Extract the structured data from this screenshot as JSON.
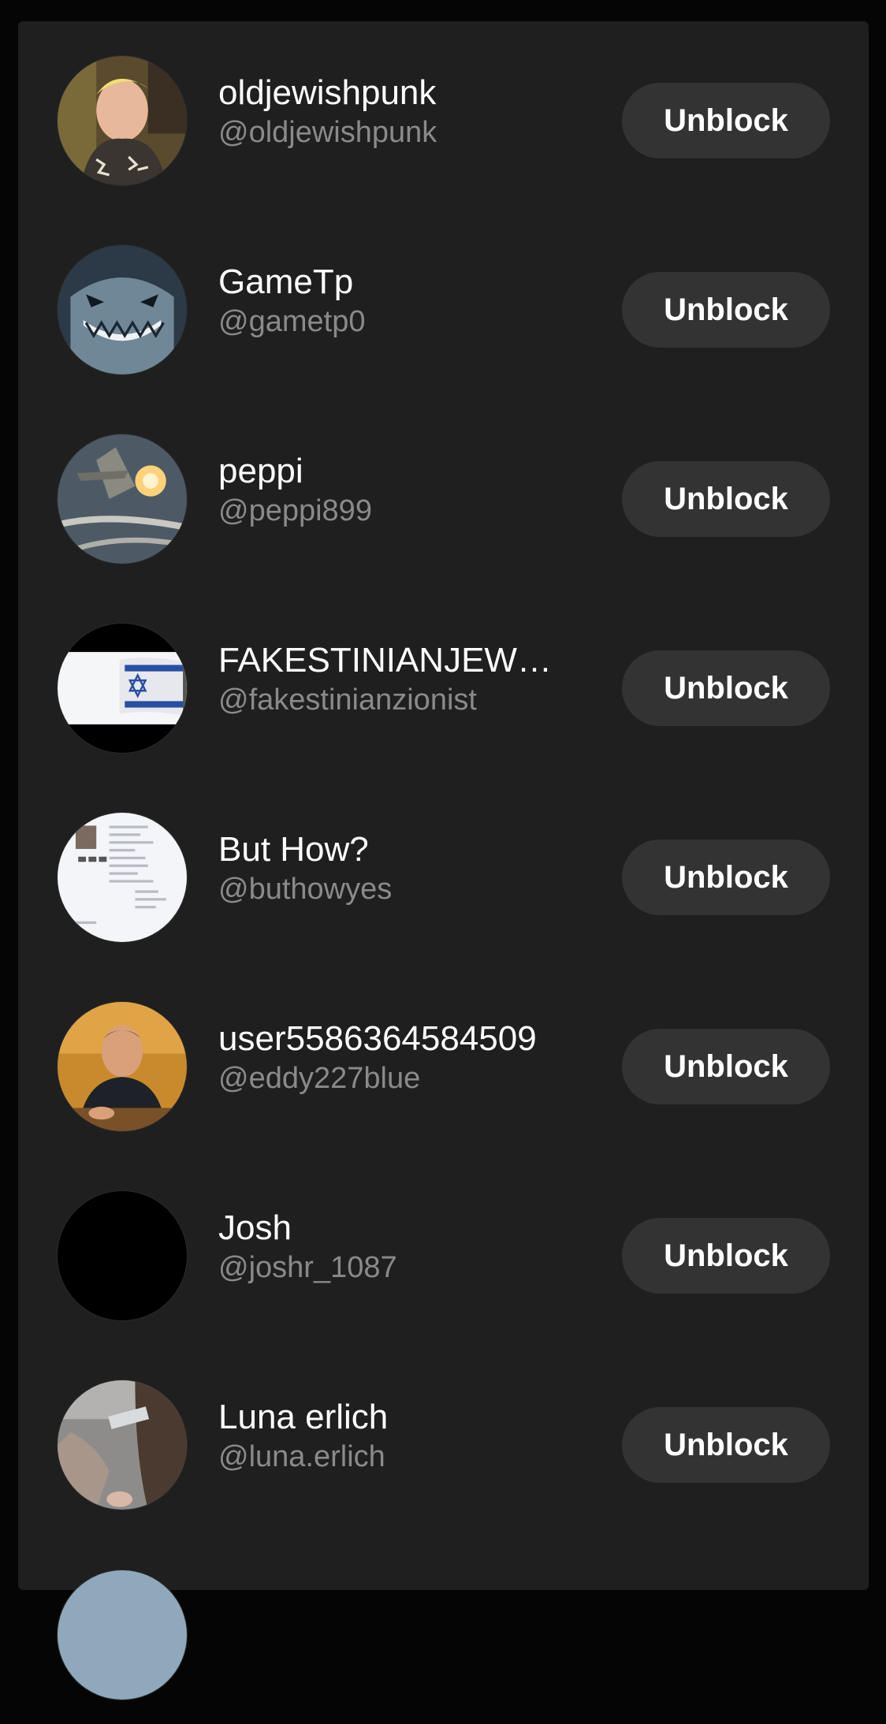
{
  "blocked_accounts": [
    {
      "display_name": "oldjewishpunk",
      "handle": "@oldjewishpunk",
      "avatar": "portrait-photo-avatar",
      "button_label": "Unblock"
    },
    {
      "display_name": "GameTp",
      "handle": "@gametp0",
      "avatar": "shark-character-avatar",
      "button_label": "Unblock"
    },
    {
      "display_name": "peppi",
      "handle": "@peppi899",
      "avatar": "fighter-jet-flares-avatar",
      "button_label": "Unblock"
    },
    {
      "display_name": "FAKESTINIANJEW…",
      "handle": "@fakestinianzionist",
      "avatar": "israel-flag-avatar",
      "button_label": "Unblock"
    },
    {
      "display_name": "But How?",
      "handle": "@buthowyes",
      "avatar": "document-screenshot-avatar",
      "button_label": "Unblock"
    },
    {
      "display_name": "user5586364584509",
      "handle": "@eddy227blue",
      "avatar": "man-photo-avatar",
      "button_label": "Unblock"
    },
    {
      "display_name": "Josh",
      "handle": "@joshr_1087",
      "avatar": "black-avatar",
      "button_label": "Unblock"
    },
    {
      "display_name": "Luna erlich",
      "handle": "@luna.erlich",
      "avatar": "selfie-photo-avatar",
      "button_label": "Unblock"
    }
  ],
  "colors": {
    "background": "#050505",
    "panel": "#1f1f1f",
    "button": "#333333",
    "name_text": "#ffffff",
    "handle_text": "#8a8a8a"
  }
}
